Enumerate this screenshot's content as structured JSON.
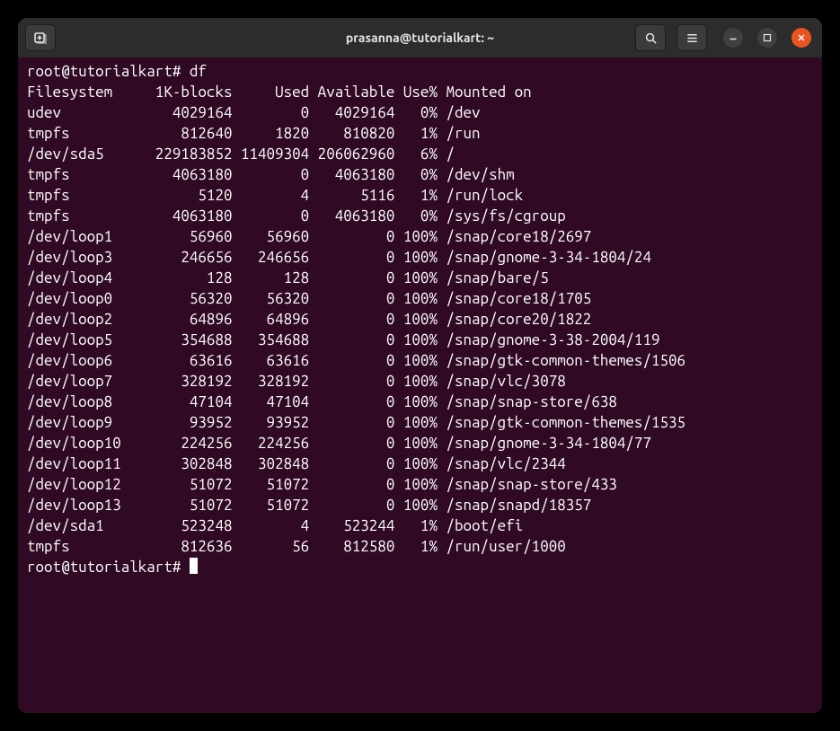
{
  "window": {
    "title": "prasanna@tutorialkart: ~"
  },
  "prompt": "root@tutorialkart#",
  "command": "df",
  "header": {
    "filesystem": "Filesystem",
    "blocks": "1K-blocks",
    "used": "Used",
    "available": "Available",
    "usepct": "Use%",
    "mounted": "Mounted on"
  },
  "rows": [
    {
      "fs": "udev",
      "blocks": "4029164",
      "used": "0",
      "avail": "4029164",
      "pct": "0%",
      "mnt": "/dev"
    },
    {
      "fs": "tmpfs",
      "blocks": "812640",
      "used": "1820",
      "avail": "810820",
      "pct": "1%",
      "mnt": "/run"
    },
    {
      "fs": "/dev/sda5",
      "blocks": "229183852",
      "used": "11409304",
      "avail": "206062960",
      "pct": "6%",
      "mnt": "/"
    },
    {
      "fs": "tmpfs",
      "blocks": "4063180",
      "used": "0",
      "avail": "4063180",
      "pct": "0%",
      "mnt": "/dev/shm"
    },
    {
      "fs": "tmpfs",
      "blocks": "5120",
      "used": "4",
      "avail": "5116",
      "pct": "1%",
      "mnt": "/run/lock"
    },
    {
      "fs": "tmpfs",
      "blocks": "4063180",
      "used": "0",
      "avail": "4063180",
      "pct": "0%",
      "mnt": "/sys/fs/cgroup"
    },
    {
      "fs": "/dev/loop1",
      "blocks": "56960",
      "used": "56960",
      "avail": "0",
      "pct": "100%",
      "mnt": "/snap/core18/2697"
    },
    {
      "fs": "/dev/loop3",
      "blocks": "246656",
      "used": "246656",
      "avail": "0",
      "pct": "100%",
      "mnt": "/snap/gnome-3-34-1804/24"
    },
    {
      "fs": "/dev/loop4",
      "blocks": "128",
      "used": "128",
      "avail": "0",
      "pct": "100%",
      "mnt": "/snap/bare/5"
    },
    {
      "fs": "/dev/loop0",
      "blocks": "56320",
      "used": "56320",
      "avail": "0",
      "pct": "100%",
      "mnt": "/snap/core18/1705"
    },
    {
      "fs": "/dev/loop2",
      "blocks": "64896",
      "used": "64896",
      "avail": "0",
      "pct": "100%",
      "mnt": "/snap/core20/1822"
    },
    {
      "fs": "/dev/loop5",
      "blocks": "354688",
      "used": "354688",
      "avail": "0",
      "pct": "100%",
      "mnt": "/snap/gnome-3-38-2004/119"
    },
    {
      "fs": "/dev/loop6",
      "blocks": "63616",
      "used": "63616",
      "avail": "0",
      "pct": "100%",
      "mnt": "/snap/gtk-common-themes/1506"
    },
    {
      "fs": "/dev/loop7",
      "blocks": "328192",
      "used": "328192",
      "avail": "0",
      "pct": "100%",
      "mnt": "/snap/vlc/3078"
    },
    {
      "fs": "/dev/loop8",
      "blocks": "47104",
      "used": "47104",
      "avail": "0",
      "pct": "100%",
      "mnt": "/snap/snap-store/638"
    },
    {
      "fs": "/dev/loop9",
      "blocks": "93952",
      "used": "93952",
      "avail": "0",
      "pct": "100%",
      "mnt": "/snap/gtk-common-themes/1535"
    },
    {
      "fs": "/dev/loop10",
      "blocks": "224256",
      "used": "224256",
      "avail": "0",
      "pct": "100%",
      "mnt": "/snap/gnome-3-34-1804/77"
    },
    {
      "fs": "/dev/loop11",
      "blocks": "302848",
      "used": "302848",
      "avail": "0",
      "pct": "100%",
      "mnt": "/snap/vlc/2344"
    },
    {
      "fs": "/dev/loop12",
      "blocks": "51072",
      "used": "51072",
      "avail": "0",
      "pct": "100%",
      "mnt": "/snap/snap-store/433"
    },
    {
      "fs": "/dev/loop13",
      "blocks": "51072",
      "used": "51072",
      "avail": "0",
      "pct": "100%",
      "mnt": "/snap/snapd/18357"
    },
    {
      "fs": "/dev/sda1",
      "blocks": "523248",
      "used": "4",
      "avail": "523244",
      "pct": "1%",
      "mnt": "/boot/efi"
    },
    {
      "fs": "tmpfs",
      "blocks": "812636",
      "used": "56",
      "avail": "812580",
      "pct": "1%",
      "mnt": "/run/user/1000"
    }
  ],
  "col_widths": {
    "fs": 14,
    "blocks": 9,
    "used": 8,
    "avail": 9,
    "pct": 4
  }
}
